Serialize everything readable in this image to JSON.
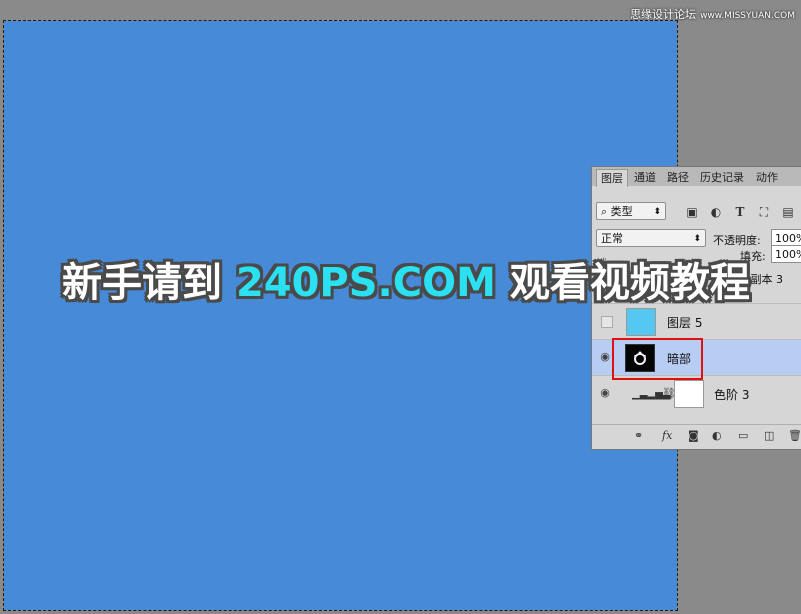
{
  "watermark": {
    "text": "思缘设计论坛",
    "url": "www.MISSYUAN.COM"
  },
  "overlay": {
    "before": "新手请到 ",
    "highlight": "240PS.COM",
    "after": " 观看视频教程"
  },
  "panel": {
    "tabs": [
      "图层",
      "通道",
      "路径",
      "历史记录",
      "动作"
    ],
    "filter_select": "类型",
    "blend_mode": "正常",
    "opacity_label": "不透明度:",
    "opacity_value": "100%",
    "fill_label": "填充:",
    "fill_value": "100%",
    "partial_layer_text": "8 副本 3",
    "layers": [
      {
        "name": "图层 5",
        "visible": false
      },
      {
        "name": "暗部",
        "visible": true
      },
      {
        "name": "色阶 3",
        "visible": true
      }
    ]
  },
  "colors": {
    "canvas": "#468ad8",
    "highlight_text": "#2be0f0",
    "selection_box": "#e01010"
  }
}
